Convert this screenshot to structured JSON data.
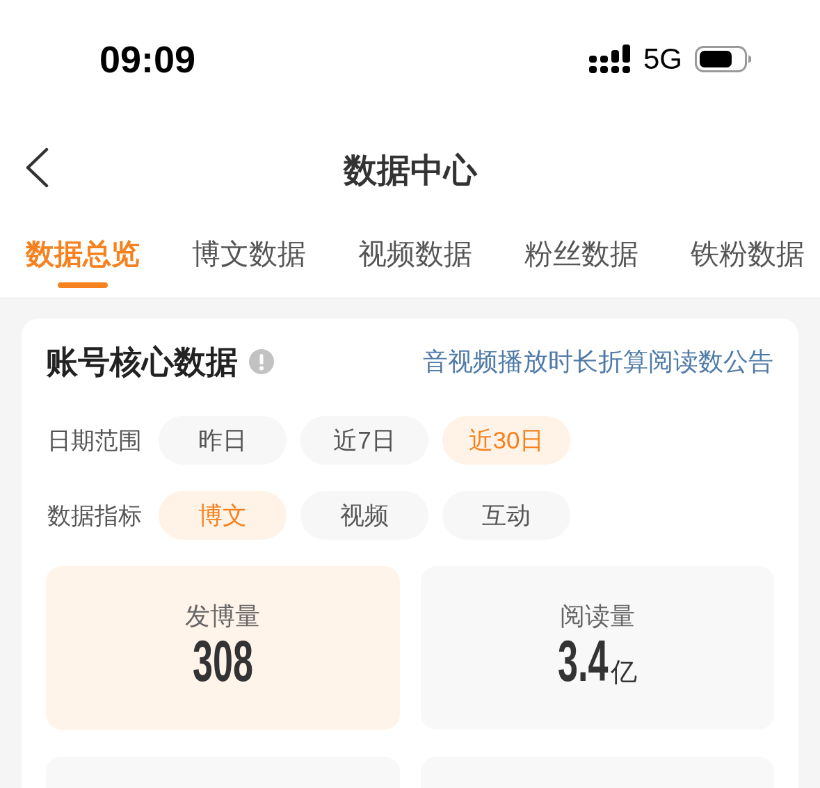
{
  "status_bar": {
    "time": "09:09",
    "network": "5G"
  },
  "nav": {
    "title": "数据中心"
  },
  "tabs": [
    {
      "label": "数据总览",
      "selected": true
    },
    {
      "label": "博文数据",
      "selected": false
    },
    {
      "label": "视频数据",
      "selected": false
    },
    {
      "label": "粉丝数据",
      "selected": false
    },
    {
      "label": "铁粉数据",
      "selected": false
    }
  ],
  "card": {
    "title": "账号核心数据",
    "link": "音视频播放时长折算阅读数公告",
    "filters": [
      {
        "label": "日期范围",
        "options": [
          {
            "label": "昨日",
            "selected": false
          },
          {
            "label": "近7日",
            "selected": false
          },
          {
            "label": "近30日",
            "selected": true
          }
        ]
      },
      {
        "label": "数据指标",
        "options": [
          {
            "label": "博文",
            "selected": true
          },
          {
            "label": "视频",
            "selected": false
          },
          {
            "label": "互动",
            "selected": false
          }
        ]
      }
    ],
    "stats": [
      {
        "label": "发博量",
        "value": "308",
        "selected": true
      },
      {
        "label": "阅读量",
        "value": "3.4",
        "unit": "亿",
        "selected": false
      },
      {
        "selected": false
      },
      {
        "selected": false
      }
    ]
  }
}
